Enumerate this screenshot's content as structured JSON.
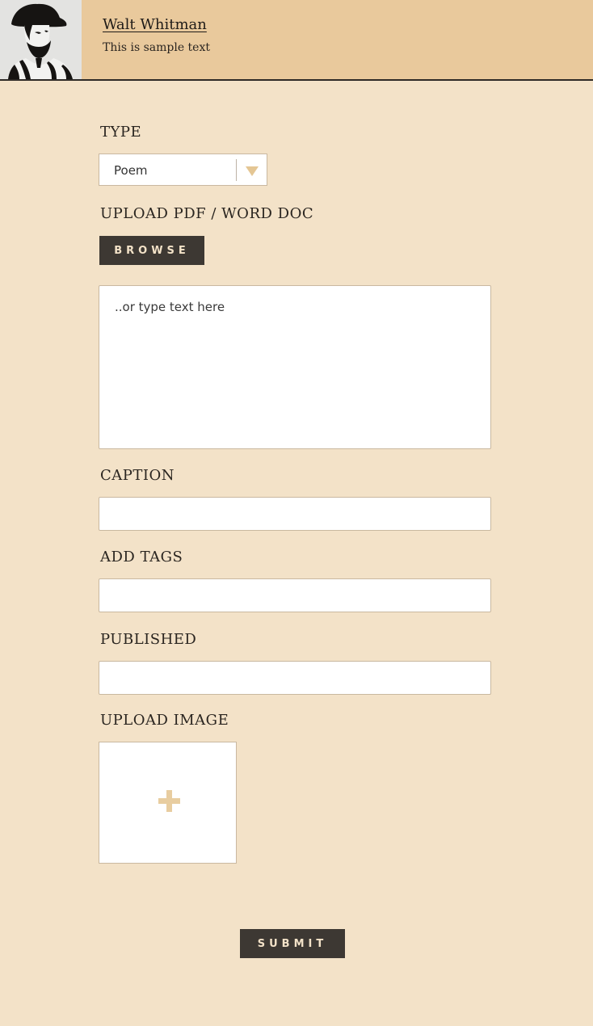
{
  "header": {
    "author_name": "Walt Whitman",
    "subtitle": "This is sample text"
  },
  "form": {
    "type_label": "TYPE",
    "type_value": "Poem",
    "upload_doc_label": "UPLOAD PDF / WORD DOC",
    "browse_label": "BROWSE",
    "text_placeholder": "..or type text here",
    "caption_label": "CAPTION",
    "caption_value": "",
    "tags_label": "ADD TAGS",
    "tags_value": "",
    "published_label": "PUBLISHED",
    "published_value": "",
    "upload_image_label": "UPLOAD IMAGE",
    "submit_label": "SUBMIT"
  },
  "icons": {
    "dropdown": "chevron-down-icon",
    "add_image": "plus-icon"
  },
  "colors": {
    "page_background": "#f3e2c8",
    "header_background": "#e9c99c",
    "button_dark": "#3d3833",
    "accent": "#e4c694"
  }
}
